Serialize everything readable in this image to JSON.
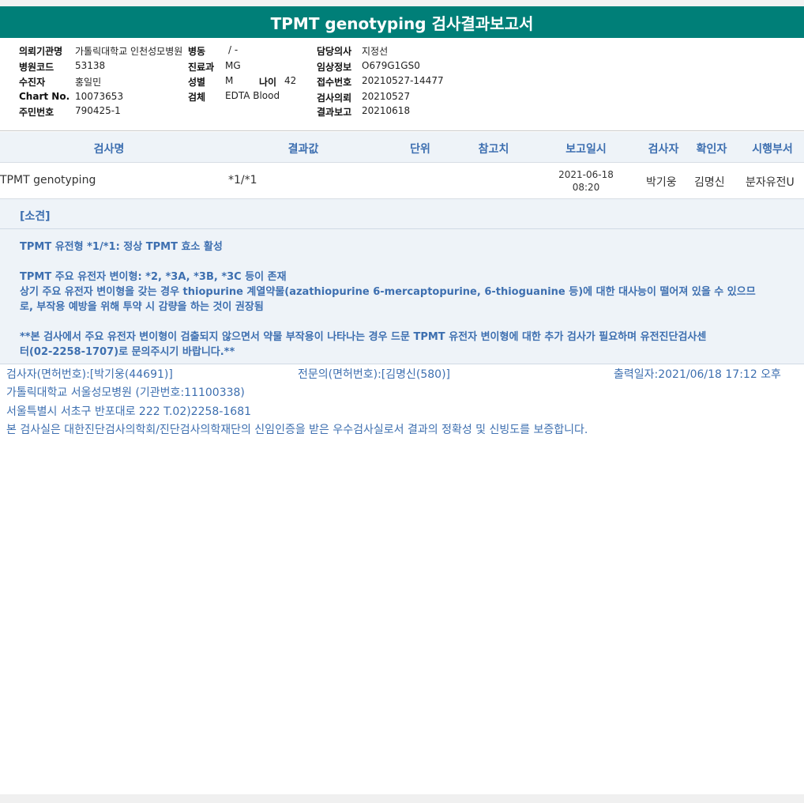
{
  "title": "TPMT genotyping 검사결과보고서",
  "info": {
    "hospital": {
      "label": "의뢰기관명",
      "value": "가톨릭대학교 인천성모병원"
    },
    "ward": {
      "label": "병동",
      "value": "/ -"
    },
    "doctor": {
      "label": "담당의사",
      "value": "지정선"
    },
    "hospital_code": {
      "label": "병원코드",
      "value": "53138"
    },
    "department": {
      "label": "진료과",
      "value": "MG"
    },
    "clinical_info": {
      "label": "임상정보",
      "value": "O679G1GS0"
    },
    "patient": {
      "label": "수진자",
      "value": "홍일민"
    },
    "sex": {
      "label": "성별",
      "value": "M"
    },
    "age": {
      "label": "나이",
      "value": "42"
    },
    "receipt_no": {
      "label": "접수번호",
      "value": "20210527-14477"
    },
    "chart_no": {
      "label": "Chart No.",
      "value": "10073653"
    },
    "specimen": {
      "label": "검체",
      "value": "EDTA Blood"
    },
    "request_date": {
      "label": "검사의뢰",
      "value": "20210527"
    },
    "resident_no": {
      "label": "주민번호",
      "value": "790425-1"
    },
    "report_date": {
      "label": "결과보고",
      "value": "20210618"
    }
  },
  "table": {
    "headers": [
      "검사명",
      "결과값",
      "단위",
      "참고치",
      "보고일시",
      "검사자",
      "확인자",
      "시행부서"
    ],
    "row": {
      "test_name": "TPMT genotyping",
      "result": "*1/*1",
      "unit": "",
      "reference": "",
      "report_date": "2021-06-18",
      "report_time": "08:20",
      "tester": "박기웅",
      "confirmer": "김명신",
      "department": "분자유전U"
    }
  },
  "opinion": {
    "header": "[소견]",
    "lines": [
      "TPMT 유전형 *1/*1: 정상 TPMT 효소 활성",
      "TPMT 주요 유전자 변이형: *2, *3A, *3B, *3C 등이 존재",
      "상기 주요 유전자 변이형을 갖는 경우 thiopurine 계열약물(azathiopurine 6-mercaptopurine, 6-thioguanine 등)에 대한 대사능이 떨어져 있을 수 있으므",
      "로, 부작용 예방을 위해 투약 시 감량을 하는 것이 권장됨",
      "**본 검사에서 주요 유전자 변이형이 검출되지 않으면서 약물 부작용이 나타나는 경우 드문 TPMT 유전자 변이형에 대한 추가 검사가 필요하며 유전진단검사센",
      "터(02-2258-1707)로 문의주시기 바랍니다.**"
    ]
  },
  "footer": {
    "tester": "검사자(면허번호):[박기웅(44691)]",
    "specialist": "전문의(면허번호):[김명신(580)]",
    "print_date": "출력일자:2021/06/18 17:12 오후",
    "institution": "가톨릭대학교 서울성모병원 (기관번호:11100338)",
    "address": "서울특별시 서초구 반포대로 222 T.02)2258-1681",
    "certification": "본 검사실은 대한진단검사의학회/진단검사의학재단의 신임인증을 받은 우수검사실로서 결과의 정확성 및 신빙도를 보증합니다."
  }
}
